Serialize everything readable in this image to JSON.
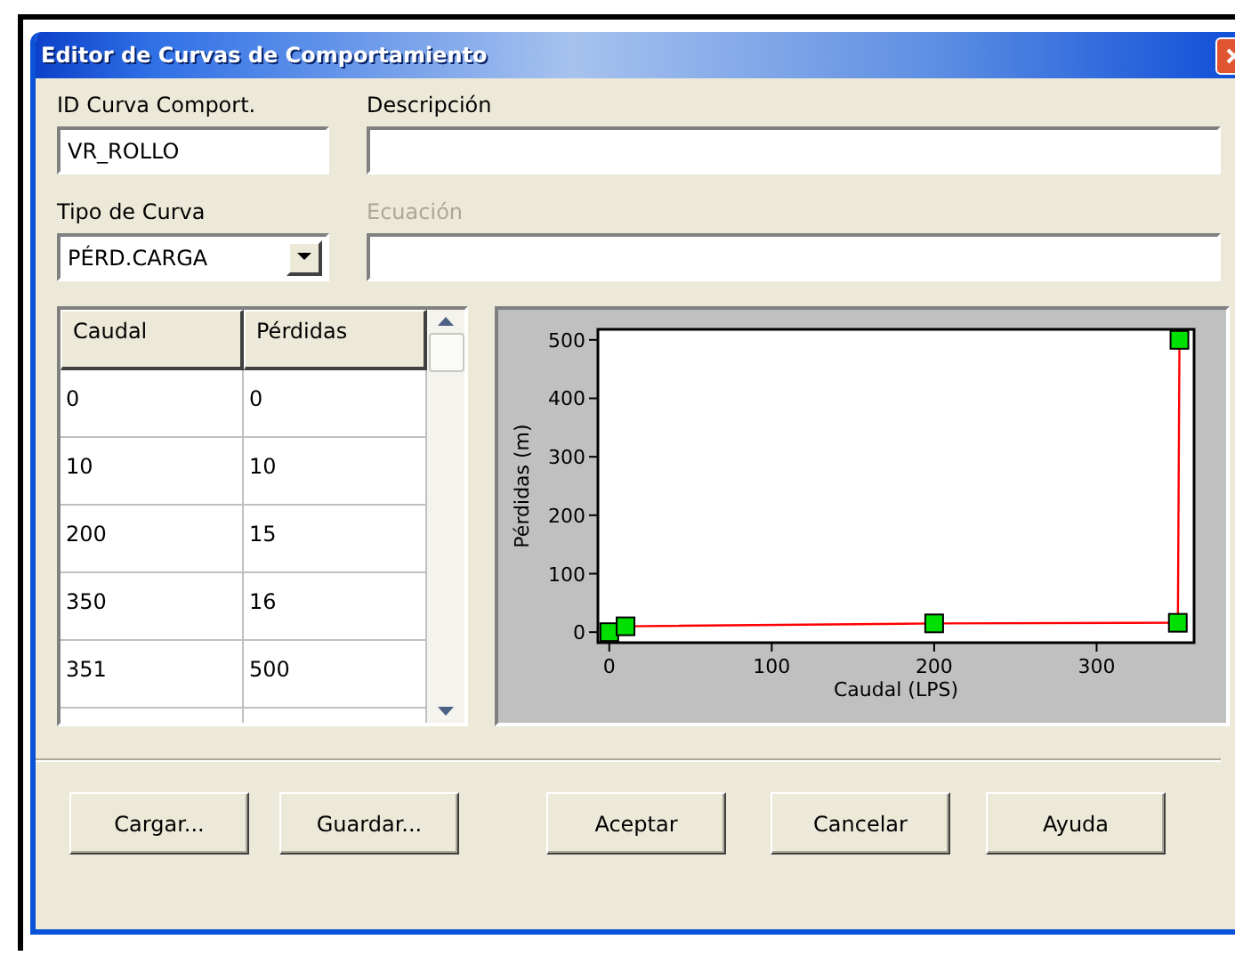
{
  "window": {
    "title": "Editor de Curvas de Comportamiento"
  },
  "id_field": {
    "label": "ID Curva Comport.",
    "value": "VR_ROLLO"
  },
  "description_field": {
    "label": "Descripción"
  },
  "curve_type": {
    "label": "Tipo de Curva",
    "value": "PÉRD.CARGA"
  },
  "equation_field": {
    "label": "Ecuación",
    "disabled": true
  },
  "table": {
    "columns": [
      "Caudal",
      "Pérdidas"
    ],
    "rows": [
      [
        "0",
        "0"
      ],
      [
        "10",
        "10"
      ],
      [
        "200",
        "15"
      ],
      [
        "350",
        "16"
      ],
      [
        "351",
        "500"
      ]
    ]
  },
  "chart": {
    "chart_data": {
      "type": "line",
      "xlabel": "Caudal (LPS)",
      "ylabel": "Pérdidas (m)",
      "x": [
        0,
        10,
        200,
        350,
        351
      ],
      "series": [
        {
          "color": "#ff0000",
          "marker": "square",
          "values": [
            0,
            10,
            15,
            16,
            500
          ]
        }
      ],
      "xlim": [
        -7,
        360
      ],
      "ylim": [
        -18,
        518
      ],
      "xticks": [
        0,
        100,
        200,
        300
      ],
      "yticks": [
        0,
        100,
        200,
        300,
        400,
        500
      ]
    }
  },
  "buttons": [
    {
      "label": "Cargar..."
    },
    {
      "label": "Guardar..."
    },
    {
      "label": "Aceptar"
    },
    {
      "label": "Cancelar"
    },
    {
      "label": "Ayuda"
    }
  ]
}
